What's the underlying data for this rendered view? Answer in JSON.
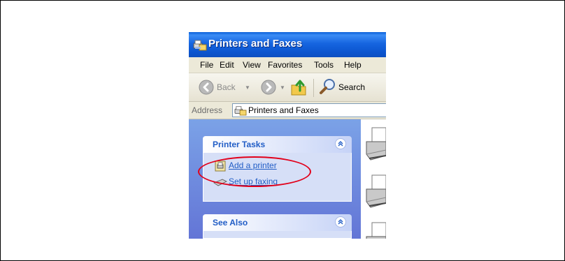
{
  "window": {
    "title": "Printers and Faxes",
    "title_icon": "printer-folder-icon",
    "titlebar_color": "#0b55cf"
  },
  "menu": {
    "items": [
      "File",
      "Edit",
      "View",
      "Favorites",
      "Tools",
      "Help"
    ]
  },
  "toolbar": {
    "back_label": "Back",
    "search_label": "Search",
    "icons": [
      "back-arrow-icon",
      "forward-arrow-icon",
      "folder-up-icon",
      "search-magnifier-icon"
    ]
  },
  "address": {
    "label": "Address",
    "value": "Printers and Faxes",
    "icon": "printer-folder-icon"
  },
  "taskpane": {
    "printer_tasks": {
      "title": "Printer Tasks",
      "items": [
        {
          "label": "Add a printer",
          "icon": "add-printer-icon"
        },
        {
          "label": "Set up faxing",
          "icon": "fax-icon"
        }
      ]
    },
    "see_also": {
      "title": "See Also"
    },
    "link_color": "#215dc6",
    "header_color": "#215dc6"
  },
  "annotation": {
    "color": "#e2001a"
  }
}
